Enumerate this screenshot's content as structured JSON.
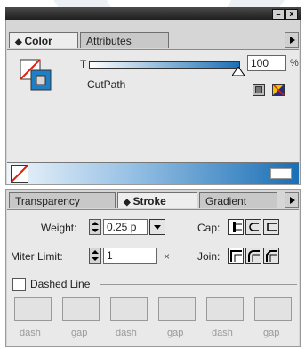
{
  "titlebar": {
    "minimize": "–",
    "close": "×"
  },
  "color_panel": {
    "tabs": [
      {
        "label": "Color"
      },
      {
        "label": "Attributes"
      }
    ],
    "tint_label": "T",
    "tint_value": "100",
    "tint_unit": "%",
    "tint_level": 1.0,
    "swatch_name": "CutPath"
  },
  "stroke_panel": {
    "tabs": [
      {
        "label": "Transparency"
      },
      {
        "label": "Stroke"
      },
      {
        "label": "Gradient"
      }
    ],
    "weight_label": "Weight:",
    "weight_value": "0.25 p",
    "cap_label": "Cap:",
    "miter_label": "Miter Limit:",
    "miter_value": "1",
    "miter_unit": "×",
    "join_label": "Join:",
    "dashed_label": "Dashed Line",
    "dash_fields": [
      {
        "label": "dash",
        "value": ""
      },
      {
        "label": "gap",
        "value": ""
      },
      {
        "label": "dash",
        "value": ""
      },
      {
        "label": "gap",
        "value": ""
      },
      {
        "label": "dash",
        "value": ""
      },
      {
        "label": "gap",
        "value": ""
      }
    ]
  }
}
